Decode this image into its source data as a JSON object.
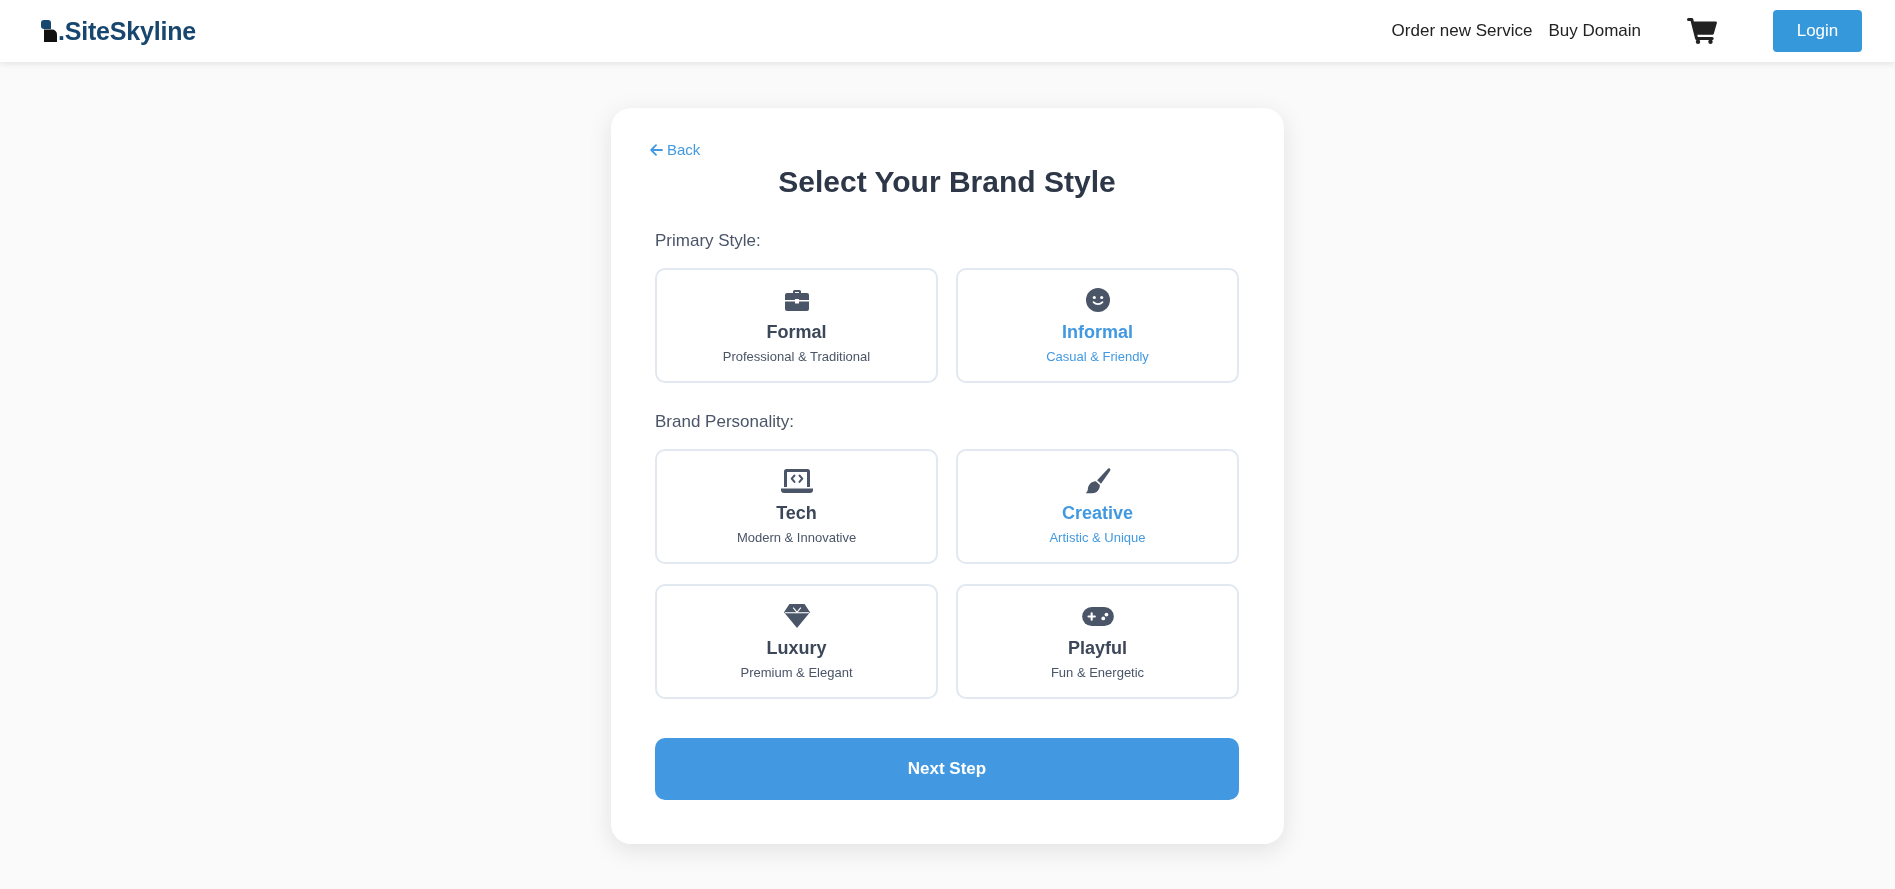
{
  "header": {
    "logo": ".SiteSkyline",
    "nav": [
      "Order new Service",
      "Buy Domain"
    ],
    "login": "Login"
  },
  "card": {
    "back": "Back",
    "title": "Select Your Brand Style",
    "sections": [
      {
        "label": "Primary Style:",
        "options": [
          {
            "title": "Formal",
            "subtitle": "Professional & Traditional",
            "selected": false
          },
          {
            "title": "Informal",
            "subtitle": "Casual & Friendly",
            "selected": true
          }
        ]
      },
      {
        "label": "Brand Personality:",
        "options": [
          {
            "title": "Tech",
            "subtitle": "Modern & Innovative",
            "selected": false
          },
          {
            "title": "Creative",
            "subtitle": "Artistic & Unique",
            "selected": true
          },
          {
            "title": "Luxury",
            "subtitle": "Premium & Elegant",
            "selected": false
          },
          {
            "title": "Playful",
            "subtitle": "Fun & Energetic",
            "selected": false
          }
        ]
      }
    ],
    "next": "Next Step"
  }
}
